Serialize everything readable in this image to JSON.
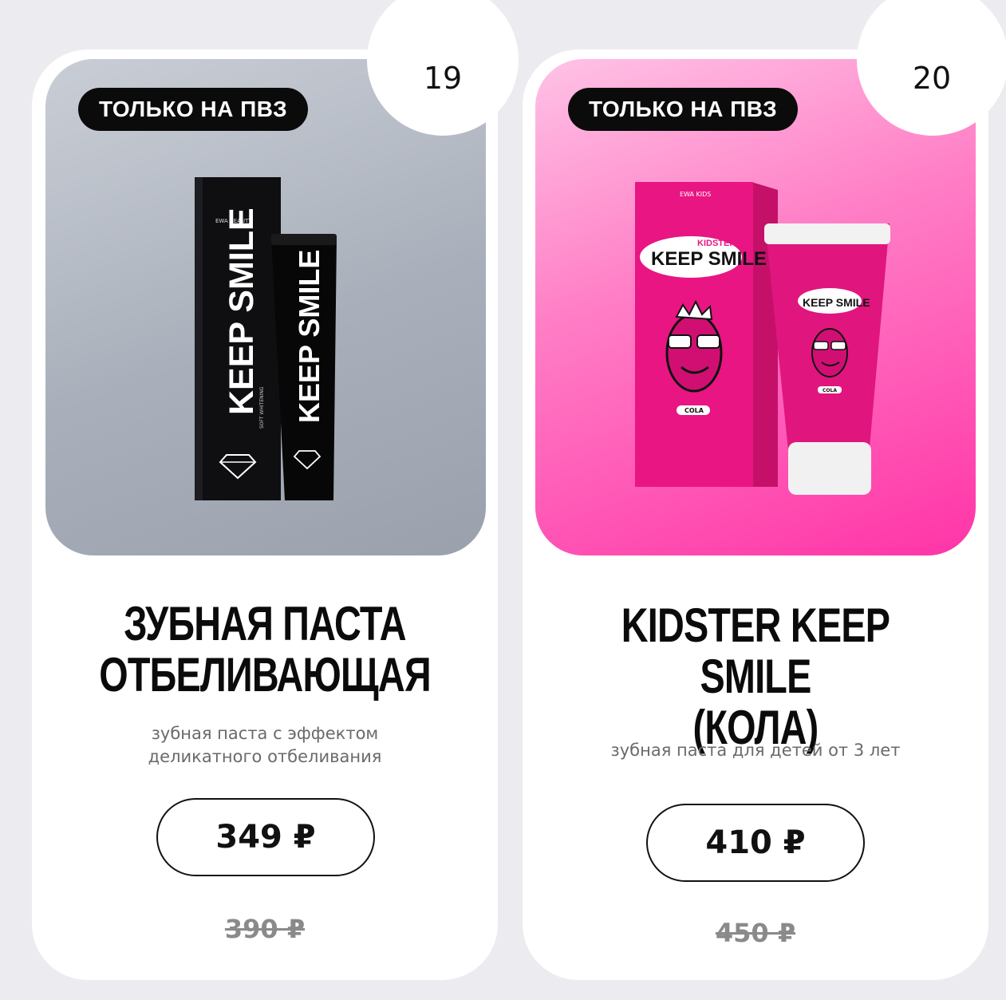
{
  "products": [
    {
      "number": "19",
      "tag": "ТОЛЬКО НА ПВЗ",
      "title_line1": "ЗУБНАЯ ПАСТА",
      "title_line2": "ОТБЕЛИВАЮЩАЯ",
      "desc_line1": "зубная паста с эффектом",
      "desc_line2": "деликатного отбеливания",
      "price": "349 ₽",
      "old_price": "390 ₽",
      "image": {
        "brand": "EWA BEAUTY",
        "box_text": "KEEP SMILE",
        "tube_text": "KEEP SMILE",
        "sub_text": "SOFT WHITENING",
        "icon": "diamond-icon"
      },
      "colors": {
        "bg": "#a9afba",
        "box": "#0d0d0f"
      }
    },
    {
      "number": "20",
      "tag": "ТОЛЬКО НА ПВЗ",
      "title_line1": "KIDSTER KEEP SMILE",
      "title_line2": "(КОЛА)",
      "desc_line1": "зубная паста для детей от 3 лет",
      "price": "410 ₽",
      "old_price": "450 ₽",
      "image": {
        "brand": "EWA KIDS",
        "small_text": "KIDSTER",
        "box_text": "KEEP SMILE",
        "flavor": "COLA",
        "icon": "cartoon-face-icon"
      },
      "colors": {
        "bg": "#ff4fb3",
        "box": "#e8197f"
      }
    }
  ]
}
